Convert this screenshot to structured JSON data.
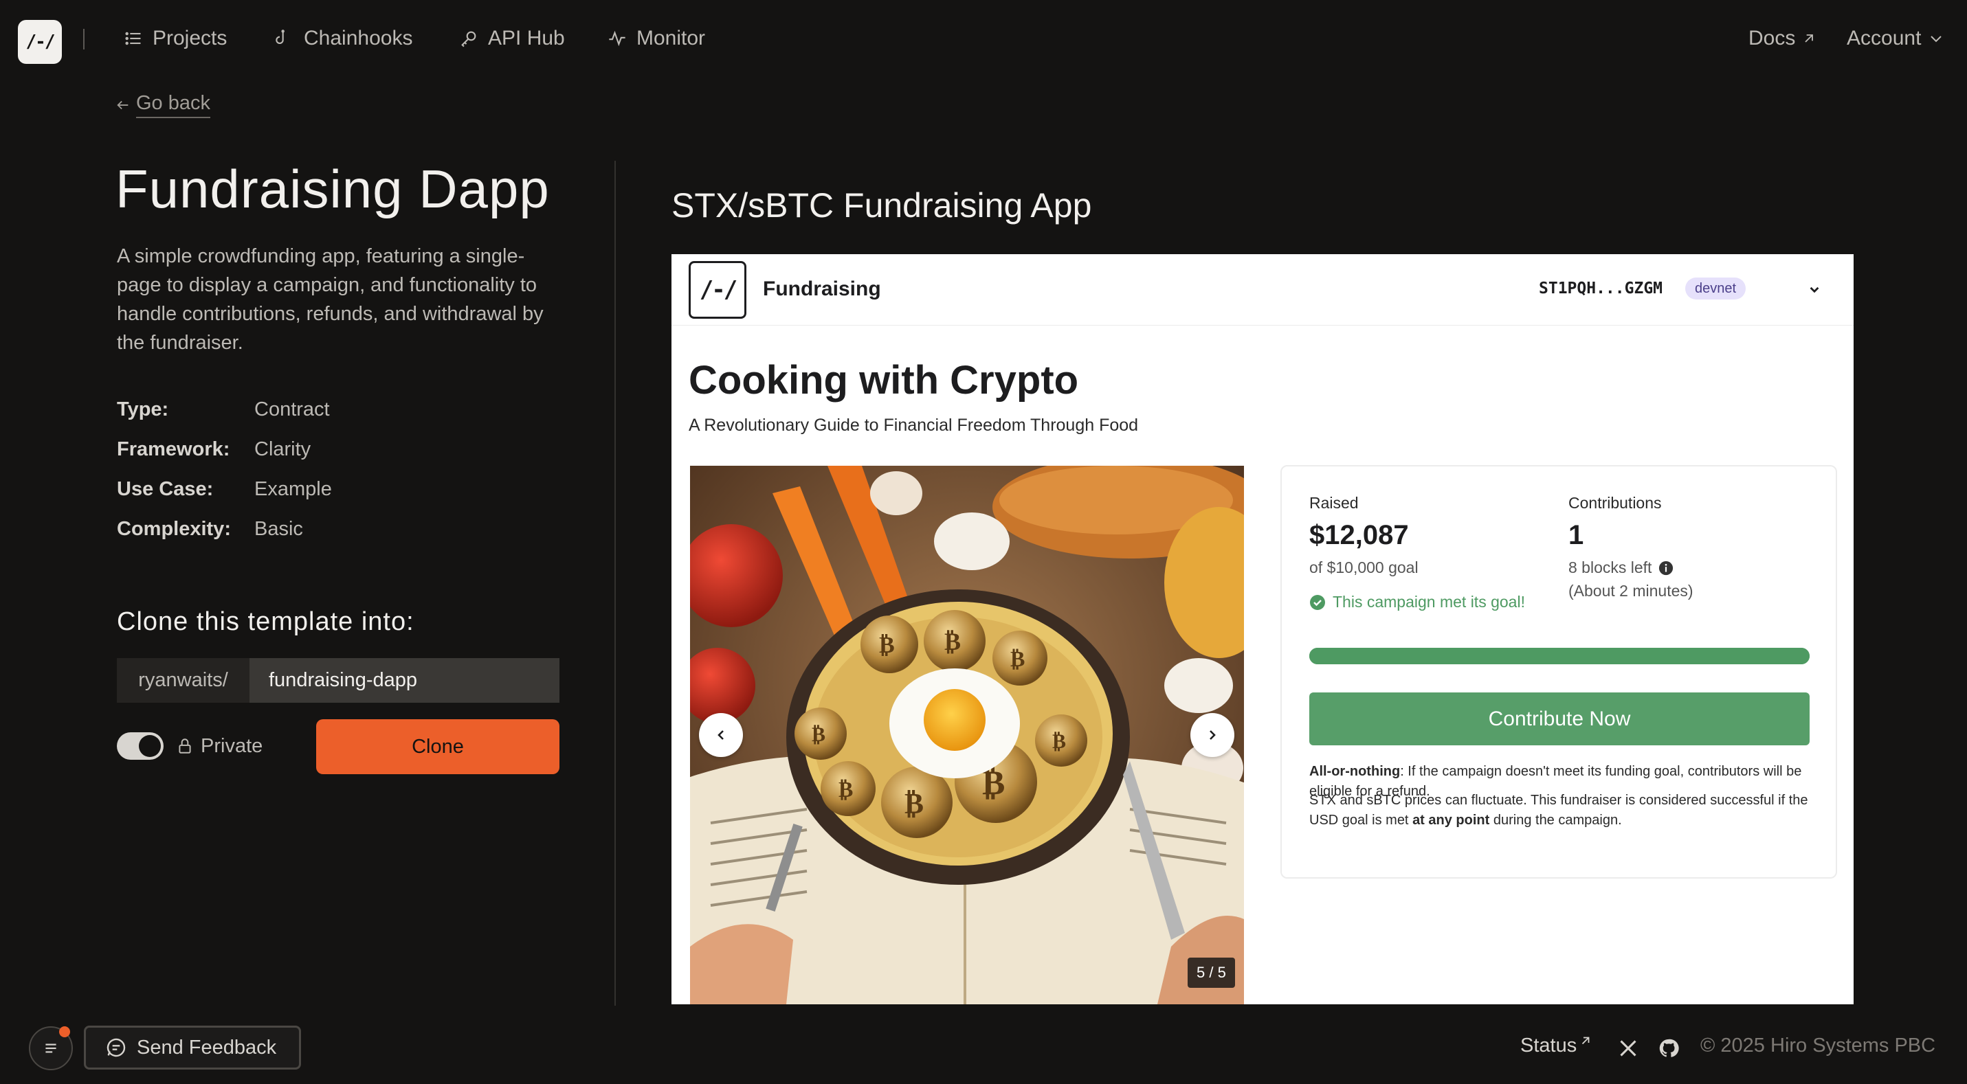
{
  "nav": {
    "logo": "/-/",
    "items": [
      {
        "label": "Projects",
        "icon": "list-icon"
      },
      {
        "label": "Chainhooks",
        "icon": "hook-icon"
      },
      {
        "label": "API Hub",
        "icon": "key-icon"
      },
      {
        "label": "Monitor",
        "icon": "activity-icon"
      }
    ],
    "docs": "Docs",
    "account": "Account"
  },
  "left": {
    "go_back": "Go back",
    "title": "Fundraising Dapp",
    "description": "A simple crowdfunding app, featuring a single-page to display a campaign, and functionality to handle contributions, refunds, and withdrawal by the fundraiser.",
    "meta": [
      {
        "key": "Type:",
        "value": "Contract"
      },
      {
        "key": "Framework:",
        "value": "Clarity"
      },
      {
        "key": "Use Case:",
        "value": "Example"
      },
      {
        "key": "Complexity:",
        "value": "Basic"
      }
    ],
    "clone_title": "Clone this template into:",
    "repo_owner": "ryanwaits/",
    "repo_name": "fundraising-dapp",
    "private_label": "Private",
    "private_on": true,
    "clone_button": "Clone"
  },
  "preview": {
    "title": "STX/sBTC Fundraising App",
    "app": {
      "logo": "/-/",
      "name": "Fundraising",
      "address": "ST1PQH...GZGM",
      "network": "devnet",
      "campaign_title": "Cooking with Crypto",
      "campaign_subtitle": "A Revolutionary Guide to Financial Freedom Through Food",
      "image_counter": "5 / 5",
      "raised_label": "Raised",
      "raised_value": "$12,087",
      "goal_text": "of $10,000 goal",
      "met_text": "This campaign met its goal!",
      "contributions_label": "Contributions",
      "contributions_value": "1",
      "blocks_left": "8 blocks left",
      "time_left": "(About 2 minutes)",
      "progress": 1.0,
      "contribute_button": "Contribute Now",
      "note1_bold": "All-or-nothing",
      "note1_text": ": If the campaign doesn't meet its funding goal, contributors will be eligible for a refund.",
      "note2_pre": "STX and sBTC prices can fluctuate. This fundraiser is considered successful if the USD goal is met ",
      "note2_bold": "at any point",
      "note2_post": " during the campaign.",
      "accent_color": "#579e69"
    }
  },
  "footer": {
    "feedback": "Send Feedback",
    "status": "Status",
    "copyright": "© 2025 Hiro Systems PBC"
  }
}
